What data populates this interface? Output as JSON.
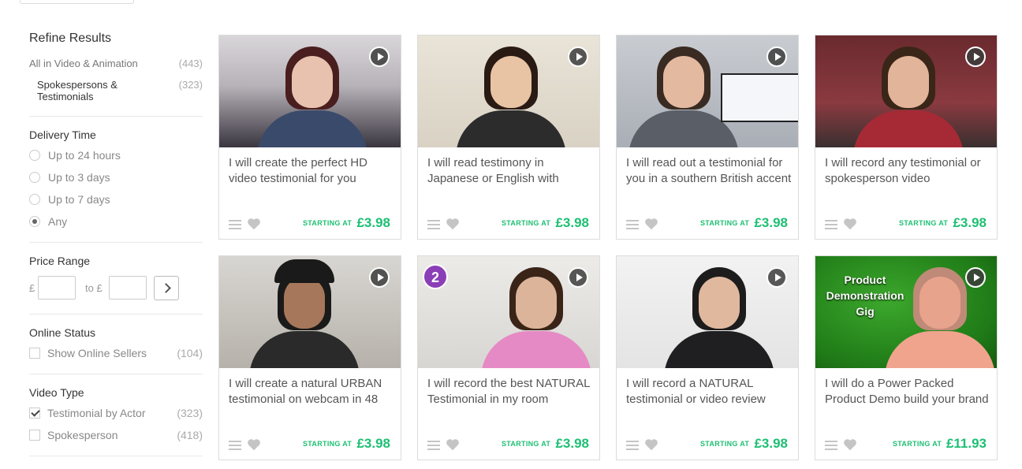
{
  "sidebar": {
    "refine_title": "Refine Results",
    "category": {
      "label": "All in Video & Animation",
      "count": "(443)"
    },
    "subcategory": {
      "label": "Spokespersons & Testimonials",
      "count": "(323)"
    },
    "delivery": {
      "title": "Delivery Time",
      "options": [
        "Up to 24 hours",
        "Up to 3 days",
        "Up to 7 days",
        "Any"
      ],
      "selected": "Any"
    },
    "price": {
      "title": "Price Range",
      "currency": "£",
      "to": "to £"
    },
    "online": {
      "title": "Online Status",
      "label": "Show Online Sellers",
      "count": "(104)"
    },
    "video_type": {
      "title": "Video Type",
      "options": [
        {
          "label": "Testimonial by Actor",
          "count": "(323)",
          "checked": true
        },
        {
          "label": "Spokesperson",
          "count": "(418)",
          "checked": false
        }
      ]
    }
  },
  "cards": [
    {
      "title": "I will create the perfect HD video testimonial for you",
      "starting": "STARTING AT",
      "price": "£3.98",
      "thumb": "woman-dark-hair-room"
    },
    {
      "title": "I will read testimony in Japanese or English with",
      "starting": "STARTING AT",
      "price": "£3.98",
      "thumb": "woman-suit-webcam"
    },
    {
      "title": "I will read out a testimonial for you in a southern British accent",
      "starting": "STARTING AT",
      "price": "£3.98",
      "thumb": "man-office-monitor"
    },
    {
      "title": "I will record any testimonial or spokesperson video",
      "starting": "STARTING AT",
      "price": "£3.98",
      "thumb": "man-studio-guitars"
    },
    {
      "title": "I will create a natural URBAN testimonial on webcam in 48",
      "starting": "STARTING AT",
      "price": "£3.98",
      "thumb": "man-cap-webcam"
    },
    {
      "title": "I will record the best NATURAL Testimonial in my room",
      "starting": "STARTING AT",
      "price": "£3.98",
      "thumb": "woman-pink-shirt",
      "badge": "2"
    },
    {
      "title": "I will record a NATURAL testimonial or video review",
      "starting": "STARTING AT",
      "price": "£3.98",
      "thumb": "man-glasses-suit"
    },
    {
      "title": "I will do a Power Packed Product Demo build your brand",
      "starting": "STARTING AT",
      "price": "£11.93",
      "thumb": "man-green-screen",
      "overlay": "Product Demonstration Gig"
    }
  ],
  "colors": {
    "accent": "#1dbf73",
    "border": "#dcdcdc",
    "icon": "#c5c5c5"
  },
  "icons": {
    "menu": "menu-icon",
    "heart": "heart-icon",
    "play": "play-icon"
  }
}
